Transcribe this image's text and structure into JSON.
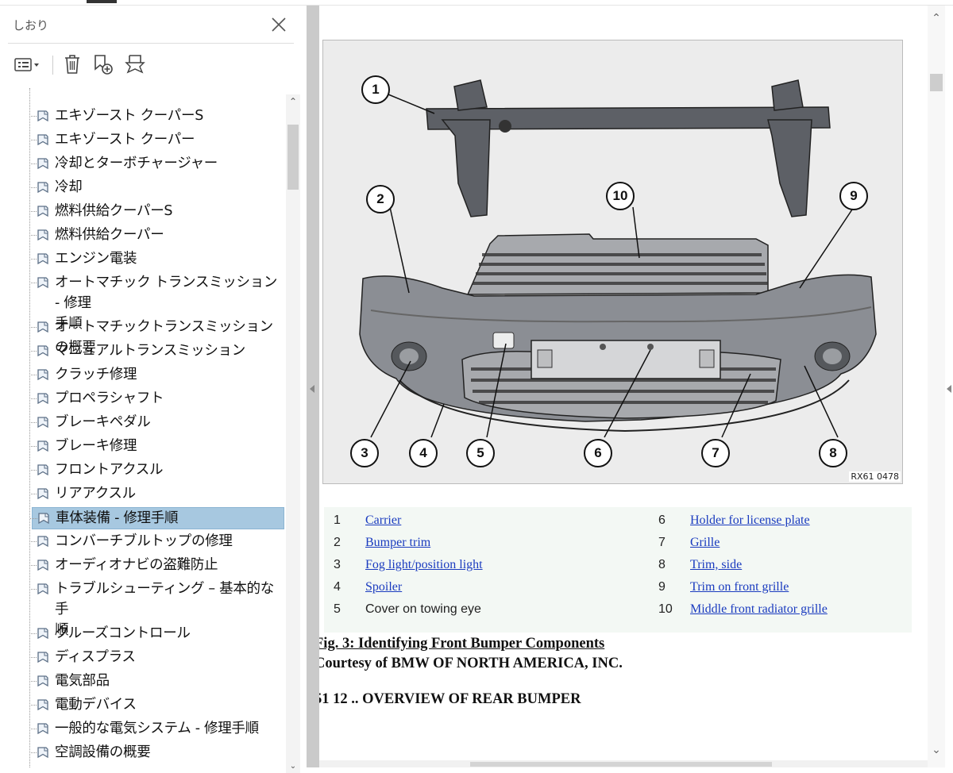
{
  "panel": {
    "title": "しおり",
    "toolbar": {
      "options_icon": "list-options-icon",
      "delete_icon": "trash-icon",
      "new_bookmark_icon": "new-bookmark-icon",
      "bookmark_search_icon": "bookmark-search-icon"
    },
    "items": [
      {
        "label": "エキゾースト クーパーS"
      },
      {
        "label": "エキゾースト クーパー"
      },
      {
        "label": "冷却とターボチャージャー"
      },
      {
        "label": "冷却"
      },
      {
        "label": "燃料供給クーパーS"
      },
      {
        "label": "燃料供給クーパー"
      },
      {
        "label": "エンジン電装"
      },
      {
        "label": "オートマチック トランスミッション - 修理",
        "label2": "手順"
      },
      {
        "label": "オートマチックトランスミッションの概要"
      },
      {
        "label": "マニュアルトランスミッション"
      },
      {
        "label": "クラッチ修理"
      },
      {
        "label": "プロペラシャフト"
      },
      {
        "label": "ブレーキペダル"
      },
      {
        "label": "ブレーキ修理"
      },
      {
        "label": "フロントアクスル"
      },
      {
        "label": "リアアクスル"
      },
      {
        "label": "車体装備 - 修理手順",
        "selected": true
      },
      {
        "label": "コンバーチブルトップの修理"
      },
      {
        "label": "オーディオナビの盗難防止"
      },
      {
        "label": "トラブルシューティング – 基本的な手",
        "label2": "順"
      },
      {
        "label": "クルーズコントロール"
      },
      {
        "label": "ディスプラス"
      },
      {
        "label": "電気部品"
      },
      {
        "label": "電動デバイス"
      },
      {
        "label": "一般的な電気システム - 修理手順"
      },
      {
        "label": "空調設備の概要"
      }
    ]
  },
  "figure": {
    "code": "RX61 0478",
    "callouts": [
      "1",
      "2",
      "3",
      "4",
      "5",
      "6",
      "7",
      "8",
      "9",
      "10"
    ]
  },
  "legend": {
    "left": [
      {
        "num": "1",
        "text": "Carrier",
        "link": true
      },
      {
        "num": "2",
        "text": "Bumper trim",
        "link": true
      },
      {
        "num": "3",
        "text": "Fog light/position light",
        "link": true
      },
      {
        "num": "4",
        "text": "Spoiler",
        "link": true
      },
      {
        "num": "5",
        "text": "Cover on towing eye",
        "link": false
      }
    ],
    "right": [
      {
        "num": "6",
        "text": "Holder for license plate",
        "link": true
      },
      {
        "num": "7",
        "text": "Grille",
        "link": true
      },
      {
        "num": "8",
        "text": "Trim, side",
        "link": true
      },
      {
        "num": "9",
        "text": "Trim on front grille",
        "link": true
      },
      {
        "num": "10",
        "text": "Middle front radiator grille",
        "link": true
      }
    ]
  },
  "caption": {
    "line1": "Fig. 3: Identifying Front Bumper Components",
    "line2": "Courtesy of BMW OF NORTH AMERICA, INC."
  },
  "section_heading": "51 12 .. OVERVIEW OF REAR BUMPER"
}
